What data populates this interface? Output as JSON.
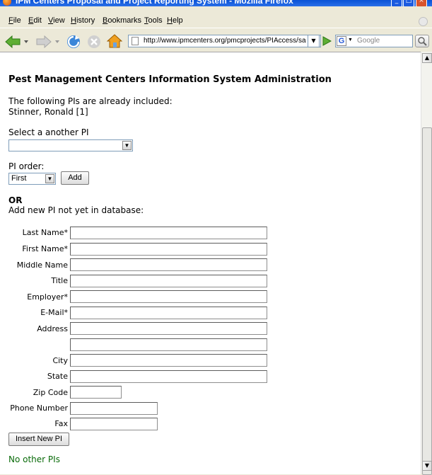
{
  "window": {
    "title": "IPM Centers Proposal and Project Reporting System - Mozilla Firefox"
  },
  "menu": [
    "File",
    "Edit",
    "View",
    "History",
    "Bookmarks",
    "Tools",
    "Help"
  ],
  "nav": {
    "url": "http://www.ipmcenters.org/pmcprojects/PIAccess/sa",
    "search_placeholder": "Google"
  },
  "page": {
    "heading": "Pest Management Centers Information System Administration",
    "included_text": "The following PIs are already included:",
    "included_pi": "Stinner, Ronald [1]",
    "select_label": "Select a another PI",
    "select_value": "",
    "order_label": "PI order:",
    "order_value": "First",
    "add_button": "Add",
    "or_label": "OR",
    "add_new_label": "Add new PI not yet in database:",
    "fields": {
      "last_name": "Last Name*",
      "first_name": "First Name*",
      "middle_name": "Middle Name",
      "title": "Title",
      "employer": "Employer*",
      "email": "E-Mail*",
      "address": "Address",
      "city": "City",
      "state": "State",
      "zip": "Zip Code",
      "phone": "Phone Number",
      "fax": "Fax"
    },
    "insert_button": "Insert New PI",
    "no_other": "No other PIs"
  }
}
